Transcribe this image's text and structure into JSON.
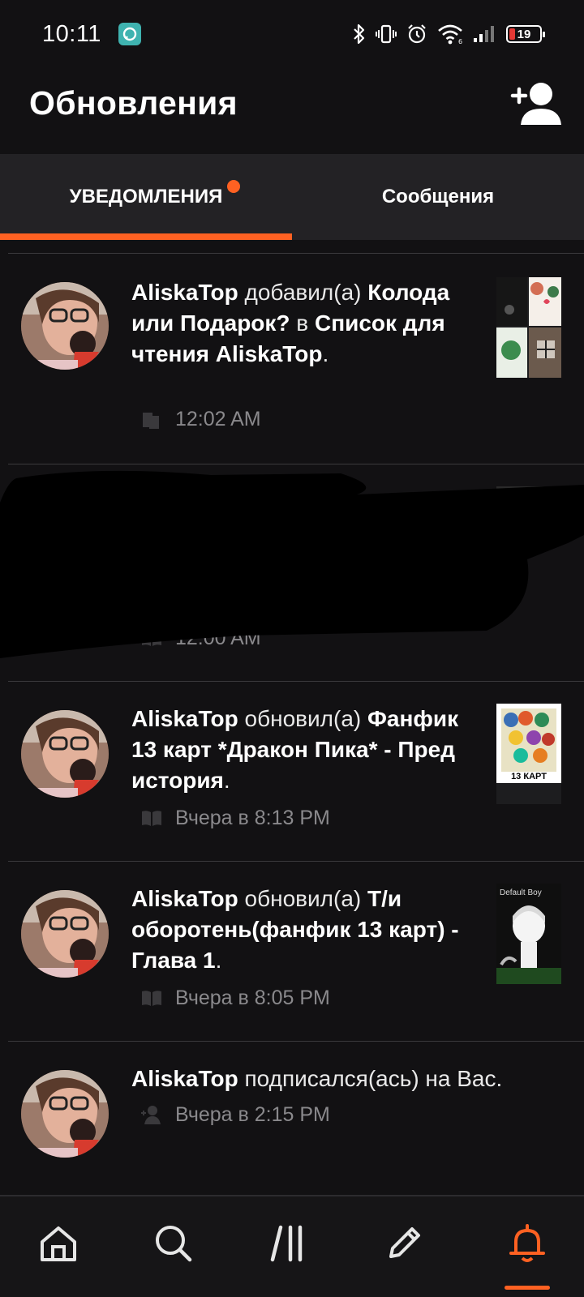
{
  "status_bar": {
    "time": "10:11",
    "battery_text": "19",
    "battery_fraction": 0.19,
    "icons": [
      "bluetooth-icon",
      "vibrate-icon",
      "alarm-icon",
      "wifi-icon",
      "signal-icon",
      "battery-icon"
    ]
  },
  "header": {
    "title": "Обновления",
    "add_friend_icon": "add-person-icon"
  },
  "tabs": [
    {
      "label": "УВЕДОМЛЕНИЯ",
      "active": true,
      "has_badge_dot": true
    },
    {
      "label": "Сообщения",
      "active": false,
      "has_badge_dot": false
    }
  ],
  "notifications": [
    {
      "user": "AliskaTop",
      "action": " добавил(а) ",
      "object": "Колода или Подарок?",
      "middle": " в ",
      "object2": "Список для чтения AliskaTop",
      "end": ".",
      "time": "12:02 AM",
      "icon": "reading-list-icon"
    },
    {
      "time": "12:00 AM",
      "icon": "book-icon",
      "redacted": true
    },
    {
      "user": "AliskaTop",
      "action": " обновил(а) ",
      "object": "Фанфик 13 карт *Дракон Пика* - Пред история",
      "end": ".",
      "time": "Вчера в 8:13 PM",
      "icon": "book-icon",
      "thumb_caption": "13 КАРТ"
    },
    {
      "user": "AliskaTop",
      "action": " обновил(а) ",
      "object": "Т/и оборотень(фанфик 13 карт) - Глава 1",
      "end": ".",
      "time": "Вчера в 8:05 PM",
      "icon": "book-icon",
      "thumb_caption": "Default Boy"
    },
    {
      "user": "AliskaTop",
      "action": " подписался(ась) на Вас.",
      "time": "Вчера в 2:15 PM",
      "icon": "follow-icon"
    }
  ],
  "bottom_nav": [
    {
      "name": "home",
      "icon": "home-icon",
      "active": false
    },
    {
      "name": "search",
      "icon": "search-icon",
      "active": false
    },
    {
      "name": "library",
      "icon": "library-icon",
      "active": false
    },
    {
      "name": "write",
      "icon": "pencil-icon",
      "active": false
    },
    {
      "name": "notifications",
      "icon": "bell-icon",
      "active": true
    }
  ],
  "colors": {
    "accent": "#ff6122",
    "background": "#121113",
    "tabs_background": "#232225",
    "meta_text": "#8a898c"
  }
}
